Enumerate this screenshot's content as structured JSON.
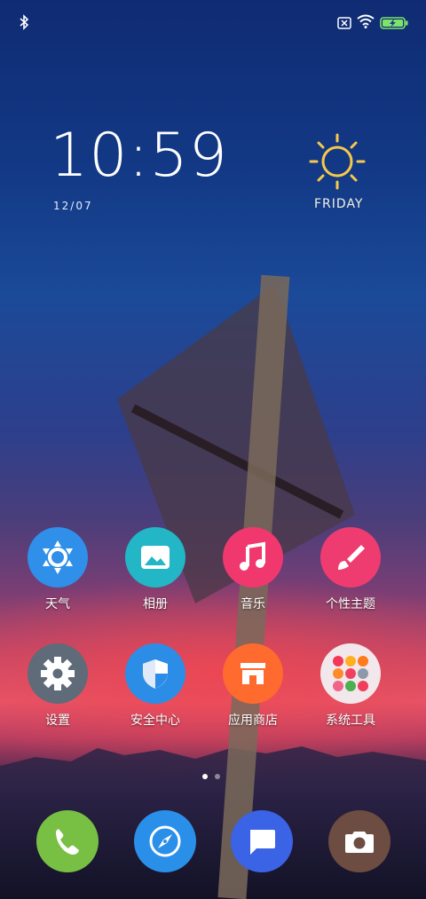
{
  "clock": {
    "time": "10:59",
    "date": "12/07"
  },
  "weather": {
    "day": "FRIDAY",
    "icon": "sun-icon"
  },
  "status": {
    "left_icons": [
      "bluetooth-icon"
    ],
    "right_icons": [
      "no-sim-icon",
      "wifi-icon",
      "battery-charging-icon"
    ]
  },
  "apps": [
    {
      "label": "天气",
      "icon": "weather-icon",
      "color": "#2f8fe9"
    },
    {
      "label": "相册",
      "icon": "gallery-icon",
      "color": "#22b6c6"
    },
    {
      "label": "音乐",
      "icon": "music-icon",
      "color": "#f0386e"
    },
    {
      "label": "个性主题",
      "icon": "theme-brush-icon",
      "color": "#ee3c70"
    },
    {
      "label": "设置",
      "icon": "gear-icon",
      "color": "#5f6b78"
    },
    {
      "label": "安全中心",
      "icon": "shield-icon",
      "color": "#2c8de6"
    },
    {
      "label": "应用商店",
      "icon": "store-icon",
      "color": "#ff6a2f"
    },
    {
      "label": "系统工具",
      "icon": "folder-icon",
      "color": "#f2e7ea"
    }
  ],
  "dock": [
    {
      "icon": "phone-icon",
      "color": "#78c043"
    },
    {
      "icon": "compass-browser-icon",
      "color": "#2a8fe8"
    },
    {
      "icon": "message-icon",
      "color": "#3b63e6"
    },
    {
      "icon": "camera-icon",
      "color": "#6d4c41"
    }
  ],
  "page_indicator": {
    "count": 2,
    "active": 1
  }
}
